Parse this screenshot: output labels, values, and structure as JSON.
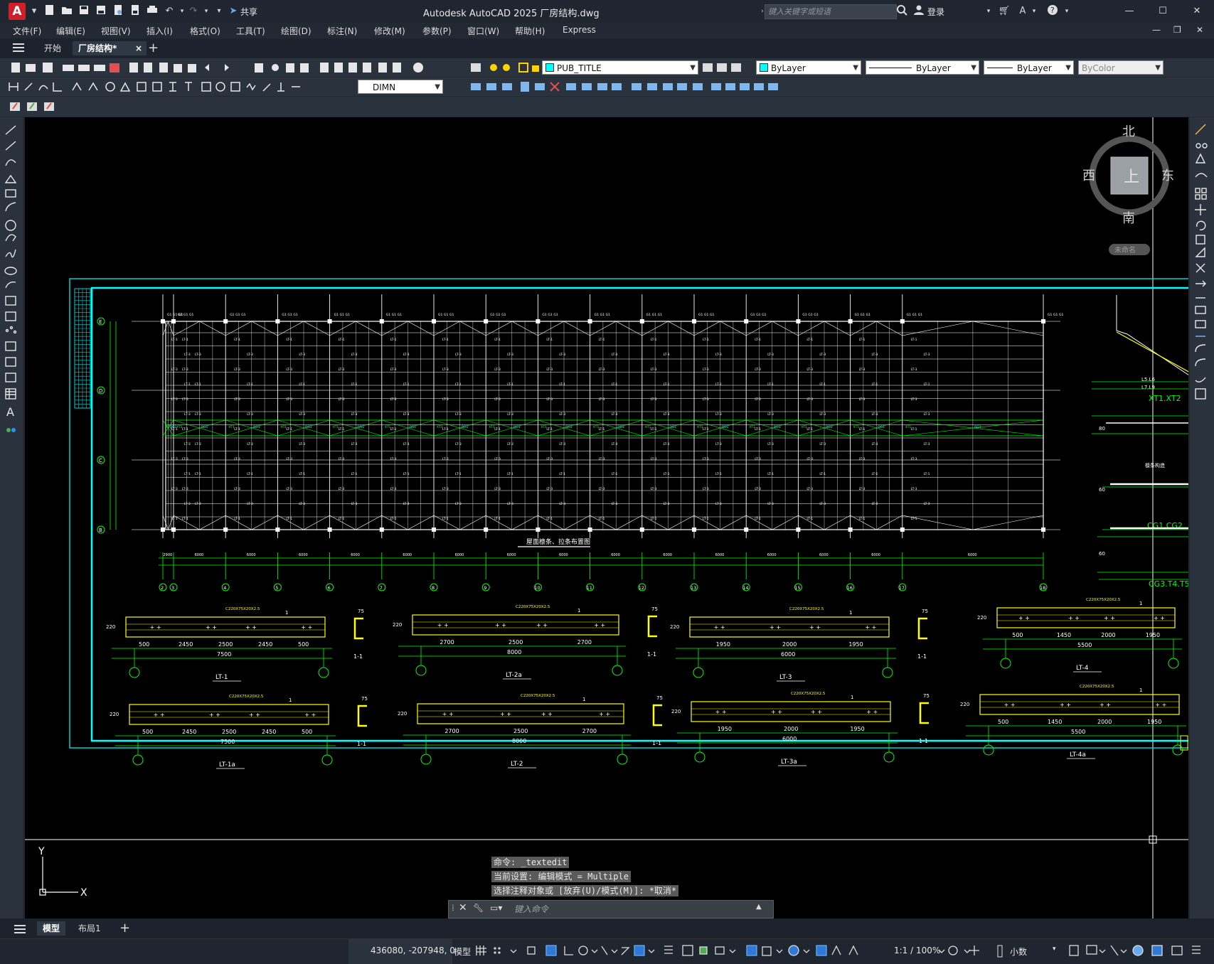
{
  "app": {
    "logo_letter": "A",
    "title": "Autodesk AutoCAD 2025    厂房结构.dwg",
    "share_label": "共享",
    "search_placeholder": "键入关键字或短语",
    "login_label": "登录"
  },
  "menu": [
    "文件(F)",
    "编辑(E)",
    "视图(V)",
    "插入(I)",
    "格式(O)",
    "工具(T)",
    "绘图(D)",
    "标注(N)",
    "修改(M)",
    "参数(P)",
    "窗口(W)",
    "帮助(H)",
    "Express"
  ],
  "tabs": {
    "start": "开始",
    "doc": "厂房结构*",
    "close": "×",
    "add": "+"
  },
  "properties": {
    "layer": "PUB_TITLE",
    "color": "ByLayer",
    "linetype": "ByLayer",
    "lineweight": "ByLayer",
    "plotstyle": "ByColor",
    "dimstyle": "DIMN"
  },
  "viewcube": {
    "north": "北",
    "south": "南",
    "east": "东",
    "west": "西",
    "top": "上",
    "ucs": "未命名"
  },
  "drawing": {
    "grid_labels_left": [
      "E",
      "D",
      "C",
      "B"
    ],
    "column_labels": [
      "2",
      "3",
      "4",
      "5",
      "6",
      "7",
      "8",
      "9",
      "10",
      "11",
      "12",
      "13",
      "14",
      "15",
      "16",
      "17",
      "18"
    ],
    "plan_title": "屋面檩条、拉条布置图",
    "dim_labels": [
      "2900",
      "6000",
      "6000",
      "6000",
      "6000",
      "6000",
      "6000",
      "6000",
      "6000",
      "6000",
      "6000",
      "6000",
      "6000",
      "6000",
      "6000",
      "6000"
    ],
    "right_labels": [
      "XT1.XT2",
      "L5.L6",
      "L7.L9",
      "80",
      "檩条构造",
      "60",
      "CG1.CG2",
      "60",
      "CG3.T4.T5"
    ],
    "beams_row1": [
      {
        "name": "LT-1",
        "len": "7500",
        "dims": [
          "500",
          "2450",
          "2500",
          "2450",
          "500"
        ],
        "spec": "C220X75X20X2.5",
        "section": "1-1"
      },
      {
        "name": "LT-2a",
        "len": "8000",
        "dims": [
          "2700",
          "2500",
          "2700"
        ],
        "spec": "C220X75X20X2.5",
        "section": "1-1"
      },
      {
        "name": "LT-3",
        "len": "6000",
        "dims": [
          "1950",
          "2000",
          "1950"
        ],
        "spec": "C220X75X20X2.5",
        "section": "1-1"
      },
      {
        "name": "LT-4",
        "len": "5500",
        "dims": [
          "500",
          "1450",
          "2000",
          "1950"
        ],
        "spec": "C220X75X20X2.5",
        "section": ""
      }
    ],
    "beams_row2": [
      {
        "name": "LT-1a",
        "len": "7500",
        "dims": [
          "500",
          "2450",
          "2500",
          "2450",
          "500"
        ],
        "spec": "C220X75X20X2.5",
        "section": "1-1"
      },
      {
        "name": "LT-2",
        "len": "8000",
        "dims": [
          "2700",
          "2500",
          "2700"
        ],
        "spec": "C220X75X20X2.5",
        "section": "1-1"
      },
      {
        "name": "LT-3a",
        "len": "6000",
        "dims": [
          "1950",
          "2000",
          "1950"
        ],
        "spec": "C220X75X20X2.5",
        "section": "1-1"
      },
      {
        "name": "LT-4a",
        "len": "5500",
        "dims": [
          "500",
          "1450",
          "2000",
          "1950"
        ],
        "spec": "C220X75X20X2.5",
        "section": ""
      }
    ]
  },
  "ucs": {
    "x": "X",
    "y": "Y"
  },
  "command": {
    "history": [
      "命令: _textedit",
      "当前设置: 编辑模式 = Multiple",
      "选择注释对象或 [放弃(U)/模式(M)]: *取消*"
    ],
    "placeholder": "键入命令"
  },
  "layout_tabs": {
    "model": "模型",
    "layout1": "布局1",
    "add": "+"
  },
  "status": {
    "coords": "436080, -207948, 0",
    "model": "模型",
    "scale": "1:1 / 100%",
    "units": "小数"
  }
}
